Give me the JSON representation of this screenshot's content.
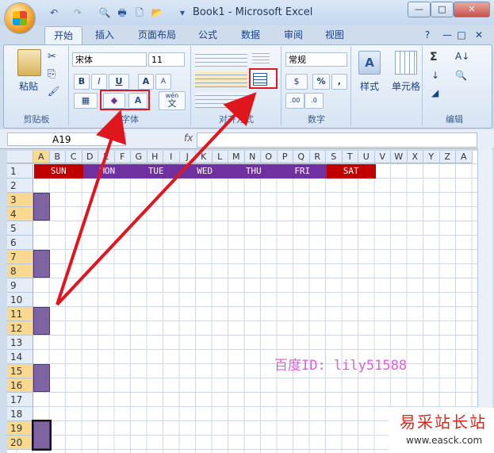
{
  "window": {
    "title": "Book1 - Microsoft Excel",
    "minimize": "—",
    "restore": "□",
    "close": "✕"
  },
  "qat": {
    "undo": "↶",
    "redo": "↷",
    "print_preview": "🔍",
    "print": "🖶",
    "new": "🗋",
    "open": "📂",
    "more": "▾"
  },
  "tabs": [
    "开始",
    "插入",
    "页面布局",
    "公式",
    "数据",
    "审阅",
    "视图"
  ],
  "ribbon_right": {
    "help": "?",
    "min": "—",
    "restore": "□",
    "close": "✕"
  },
  "clipboard": {
    "paste": "粘贴",
    "cut": "✂",
    "copy": "⎘",
    "format_painter": "🖌",
    "label": "剪贴板"
  },
  "font": {
    "name": "宋体",
    "size": "11",
    "bold": "B",
    "italic": "I",
    "underline": "U",
    "grow": "A",
    "shrink": "A",
    "border": "▦",
    "fill": "◆",
    "font_color": "A",
    "phonetic": "文",
    "phonetic_top": "wén",
    "label": "字体"
  },
  "alignment": {
    "label": "对齐方式"
  },
  "number": {
    "format": "常规",
    "currency": "$",
    "percent": "%",
    "comma": ",",
    "inc_dec": ".00",
    "dec_dec": ".0",
    "label": "数字"
  },
  "styles": {
    "label": "样式"
  },
  "cells": {
    "label": "单元格"
  },
  "editing": {
    "sum": "Σ",
    "sort": "A↓",
    "fill": "↓",
    "find": "🔍",
    "clear": "◢",
    "label": "编辑"
  },
  "formula_bar": {
    "name_box": "A19",
    "fx": "fx",
    "value": ""
  },
  "columns": [
    "A",
    "B",
    "C",
    "D",
    "E",
    "F",
    "G",
    "H",
    "I",
    "J",
    "K",
    "L",
    "M",
    "N",
    "O",
    "P",
    "Q",
    "R",
    "S",
    "T",
    "U",
    "V",
    "W",
    "X",
    "Y",
    "Z",
    "A"
  ],
  "rows": [
    "1",
    "2",
    "3",
    "4",
    "5",
    "6",
    "7",
    "8",
    "9",
    "10",
    "11",
    "12",
    "13",
    "14",
    "15",
    "16",
    "17",
    "18",
    "19",
    "20"
  ],
  "days": [
    "SUN",
    "MON",
    "TUE",
    "WED",
    "THU",
    "FRI",
    "SAT"
  ],
  "colors": {
    "sun": "#c00000",
    "weekday": "#7030a0",
    "marker": "#8064a2",
    "arrow": "#e0161e"
  },
  "watermark": "百度ID: lily51588",
  "site_logo": {
    "text": "易采站长站",
    "url": "www.easck.com"
  }
}
